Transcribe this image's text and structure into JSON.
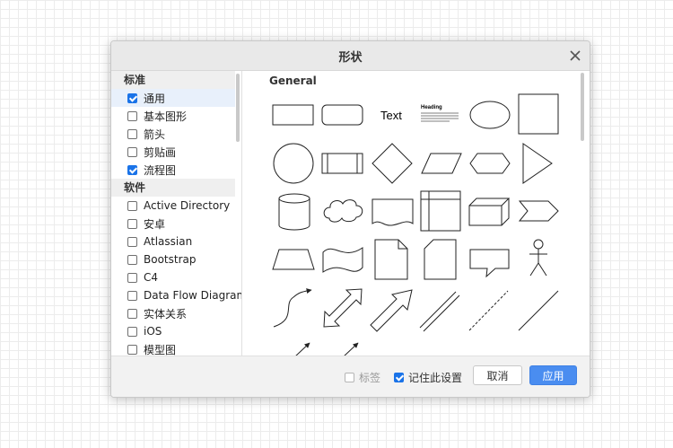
{
  "dialog": {
    "title": "形状"
  },
  "sidebar": {
    "sections": [
      {
        "header": "标准",
        "items": [
          {
            "label": "通用",
            "checked": true
          },
          {
            "label": "基本图形",
            "checked": false
          },
          {
            "label": "箭头",
            "checked": false
          },
          {
            "label": "剪贴画",
            "checked": false
          },
          {
            "label": "流程图",
            "checked": true
          }
        ]
      },
      {
        "header": "软件",
        "items": [
          {
            "label": "Active Directory",
            "checked": false
          },
          {
            "label": "安卓",
            "checked": false
          },
          {
            "label": "Atlassian",
            "checked": false
          },
          {
            "label": "Bootstrap",
            "checked": false
          },
          {
            "label": "C4",
            "checked": false
          },
          {
            "label": "Data Flow Diagram",
            "checked": false
          },
          {
            "label": "实体关系",
            "checked": false
          },
          {
            "label": "iOS",
            "checked": false
          },
          {
            "label": "模型图",
            "checked": false
          }
        ]
      }
    ]
  },
  "content": {
    "section_title": "General",
    "shapes": {
      "text_label": "Text",
      "heading_label": "Heading",
      "icons": [
        "rectangle-icon",
        "rounded-rectangle-icon",
        "text-icon",
        "heading-text-icon",
        "ellipse-icon",
        "square-icon",
        "circle-icon",
        "process-icon",
        "diamond-icon",
        "parallelogram-icon",
        "hexagon-icon",
        "triangle-icon",
        "cylinder-icon",
        "cloud-icon",
        "document-icon",
        "internal-storage-icon",
        "cube-icon",
        "step-icon",
        "trapezoid-icon",
        "tape-icon",
        "note-icon",
        "card-icon",
        "callout-icon",
        "actor-icon",
        "curved-arrow-icon",
        "bidirectional-arrow-icon",
        "single-arrow-icon",
        "double-line-icon",
        "dashed-line-icon",
        "line-icon",
        "connector-arrow-icon",
        "connector-arrow-icon"
      ]
    }
  },
  "footer": {
    "labels_checkbox": {
      "label": "标签",
      "checked": false
    },
    "remember_checkbox": {
      "label": "记住此设置",
      "checked": true
    },
    "cancel_label": "取消",
    "apply_label": "应用"
  }
}
